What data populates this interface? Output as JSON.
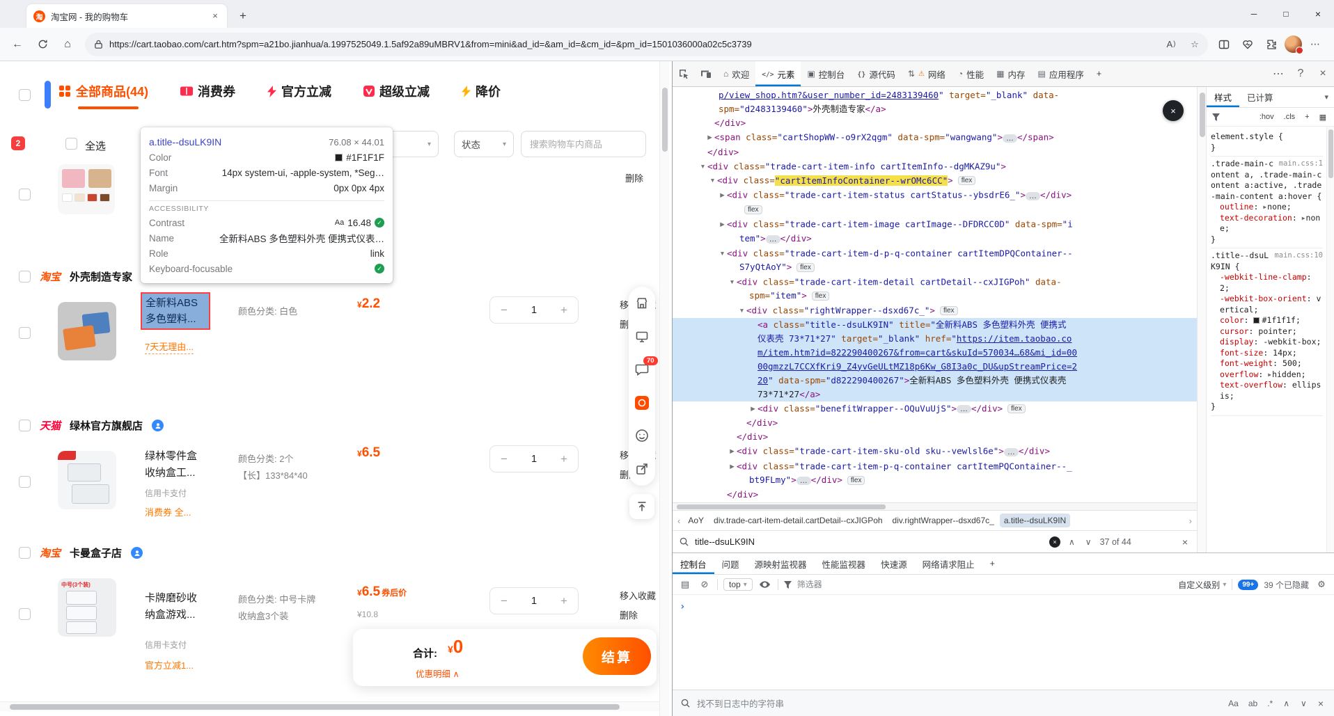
{
  "browser": {
    "tab": {
      "title": "淘宝网 - 我的购物车",
      "favicon_glyph": "淘"
    },
    "address": {
      "url": "https://cart.taobao.com/cart.htm?spm=a21bo.jianhua/a.1997525049.1.5af92a89uMBRV1&from=mini&ad_id=&am_id=&cm_id=&pm_id=1501036000a02c5c3739"
    }
  },
  "cart": {
    "nav_tabs": [
      {
        "label": "全部商品(44)"
      },
      {
        "label": "消费券"
      },
      {
        "label": "官方立减"
      },
      {
        "label": "超级立减"
      },
      {
        "label": "降价"
      }
    ],
    "filter_bar": {
      "select_all": "全选",
      "status": "状态",
      "search_placeholder": "搜索购物车内商品"
    },
    "badge_2": "2",
    "ops": {
      "move": "移入收藏",
      "del": "删除"
    },
    "inspect_tooltip": {
      "element": "a.title--dsuLK9IN",
      "size": "76.08 × 44.01",
      "color_label": "Color",
      "color_value": "#1F1F1F",
      "font_label": "Font",
      "font_value": "14px system-ui, -apple-system, *Seg…",
      "margin_label": "Margin",
      "margin_value": "0px 0px 4px",
      "a11y_header": "ACCESSIBILITY",
      "contrast_label": "Contrast",
      "contrast_aa": "Aa",
      "contrast_value": "16.48",
      "name_label": "Name",
      "name_value": "全新料ABS 多色塑料外壳 便携式仪表…",
      "role_label": "Role",
      "role_value": "link",
      "kbd_label": "Keyboard-focusable"
    },
    "shops": [
      {
        "platform": "淘宝",
        "name": "外壳制造专家",
        "item": {
          "title_l1": "全新料ABS",
          "title_l2": "多色塑料...",
          "promo": "7天无理由...",
          "sku1": "颜色分类: 白色",
          "price": "2.2",
          "qty": "1"
        }
      },
      {
        "platform": "天猫",
        "name": "绿林官方旗舰店",
        "item": {
          "title_l1": "绿林零件盒",
          "title_l2": "收纳盒工...",
          "pay": "信用卡支付",
          "promo": "消费券 全...",
          "sku1": "颜色分类: 2个",
          "sku2": "【长】133*84*40",
          "price": "6.5",
          "qty": "1"
        }
      },
      {
        "platform": "淘宝",
        "name": "卡曼盒子店",
        "item": {
          "title_l1": "卡牌磨砂收",
          "title_l2": "纳盒游戏...",
          "pay": "信用卡支付",
          "promo": "官方立减1...",
          "sku1": "颜色分类: 中号卡牌",
          "sku2": "收纳盒3个装",
          "price": "6.5",
          "price_note": "券后价",
          "price_old": "¥10.8",
          "image_label": "中号(3个装)",
          "qty": "1"
        }
      }
    ],
    "summary": {
      "label": "合计:",
      "currency": "¥",
      "amount": "0",
      "detail": "优惠明细",
      "checkout": "结算"
    },
    "side_toolbar": {
      "chat_badge": "70"
    }
  },
  "devtools": {
    "tabs": [
      {
        "label": "欢迎"
      },
      {
        "label": "元素"
      },
      {
        "label": "控制台"
      },
      {
        "label": "源代码"
      },
      {
        "label": "网络"
      },
      {
        "label": "性能"
      },
      {
        "label": "内存"
      },
      {
        "label": "应用程序"
      }
    ],
    "dom_lines": [
      {
        "ind": 66,
        "seg": [
          [
            "u",
            "p/view_shop.htm?&user_number_id=2483139460"
          ],
          [
            "v",
            "\""
          ],
          [
            "n",
            " target="
          ],
          [
            "v",
            "\"_blank\""
          ],
          [
            "n",
            " data-"
          ]
        ]
      },
      {
        "ind": 66,
        "seg": [
          [
            "n",
            "spm="
          ],
          [
            "v",
            "\"d2483139460\""
          ],
          [
            "p",
            ">"
          ],
          [
            "tx",
            "外壳制造专家"
          ],
          [
            "p",
            "</a>"
          ]
        ]
      },
      {
        "ind": 60,
        "seg": [
          [
            "p",
            "</div>"
          ]
        ]
      },
      {
        "ind": 60,
        "seg": [
          [
            "ar",
            ""
          ],
          [
            "p",
            "<span"
          ],
          [
            "n",
            " class="
          ],
          [
            "v",
            "\"cartShopWW--o9rX2qgm\""
          ],
          [
            "n",
            " data-spm="
          ],
          [
            "v",
            "\"wangwang\""
          ],
          [
            "p",
            ">"
          ],
          [
            "el",
            ""
          ],
          [
            "p",
            "</span>"
          ]
        ]
      },
      {
        "ind": 50,
        "seg": [
          [
            "p",
            "</div>"
          ]
        ]
      },
      {
        "ind": 50,
        "seg": [
          [
            "ad",
            ""
          ],
          [
            "p",
            "<div"
          ],
          [
            "n",
            " class="
          ],
          [
            "v",
            "\"trade-cart-item-info cartItemInfo--dgMKAZ9u\""
          ],
          [
            "p",
            ">"
          ]
        ]
      },
      {
        "ind": 64,
        "seg": [
          [
            "ad",
            ""
          ],
          [
            "p",
            "<div"
          ],
          [
            "n",
            " class="
          ],
          [
            "vh",
            "\"cartItemInfoContainer--wrOMc6CC\""
          ],
          [
            "p",
            ">"
          ],
          [
            "fx",
            ""
          ]
        ]
      },
      {
        "ind": 78,
        "seg": [
          [
            "ar",
            ""
          ],
          [
            "p",
            "<div"
          ],
          [
            "n",
            " class="
          ],
          [
            "v",
            "\"trade-cart-item-status cartStatus--ybsdrE6_\""
          ],
          [
            "p",
            ">"
          ],
          [
            "el",
            ""
          ],
          [
            "p",
            "</div>"
          ]
        ]
      },
      {
        "ind": 96,
        "seg": [
          [
            "fx",
            ""
          ]
        ]
      },
      {
        "ind": 78,
        "seg": [
          [
            "ar",
            ""
          ],
          [
            "p",
            "<div"
          ],
          [
            "n",
            " class="
          ],
          [
            "v",
            "\"trade-cart-item-image cartImage--DFDRCC0D\""
          ],
          [
            "n",
            " data-spm="
          ],
          [
            "v",
            "\"i"
          ]
        ]
      },
      {
        "ind": 96,
        "seg": [
          [
            "v",
            "tem\""
          ],
          [
            "p",
            ">"
          ],
          [
            "el",
            ""
          ],
          [
            "p",
            "</div>"
          ]
        ]
      },
      {
        "ind": 78,
        "seg": [
          [
            "ad",
            ""
          ],
          [
            "p",
            "<div"
          ],
          [
            "n",
            " class="
          ],
          [
            "v",
            "\"trade-cart-item-d-p-q-container cartItemDPQContainer--"
          ]
        ]
      },
      {
        "ind": 96,
        "seg": [
          [
            "v",
            "S7yQtAoY\""
          ],
          [
            "p",
            ">"
          ],
          [
            "fx",
            ""
          ]
        ]
      },
      {
        "ind": 92,
        "seg": [
          [
            "ad",
            ""
          ],
          [
            "p",
            "<div"
          ],
          [
            "n",
            " class="
          ],
          [
            "v",
            "\"trade-cart-item-detail cartDetail--cxJIGPoh\""
          ],
          [
            "n",
            " data-"
          ]
        ]
      },
      {
        "ind": 110,
        "seg": [
          [
            "n",
            "spm="
          ],
          [
            "v",
            "\"item\""
          ],
          [
            "p",
            ">"
          ],
          [
            "fx",
            ""
          ]
        ]
      },
      {
        "ind": 106,
        "seg": [
          [
            "ad",
            ""
          ],
          [
            "p",
            "<div"
          ],
          [
            "n",
            " class="
          ],
          [
            "v",
            "\"rightWrapper--dsxd67c_\""
          ],
          [
            "p",
            ">"
          ],
          [
            "fx",
            ""
          ]
        ]
      },
      {
        "ind": 122,
        "sel": true,
        "seg": [
          [
            "p",
            "<a"
          ],
          [
            "n",
            " class="
          ],
          [
            "v",
            "\"title--dsuLK9IN\""
          ],
          [
            "n",
            " title="
          ],
          [
            "v",
            "\"全新料ABS 多色塑料外壳 便携式"
          ]
        ]
      },
      {
        "ind": 122,
        "sel": true,
        "seg": [
          [
            "v",
            "仪表壳 73*71*27\""
          ],
          [
            "n",
            " target="
          ],
          [
            "v",
            "\"_blank\""
          ],
          [
            "n",
            " href="
          ],
          [
            "v",
            "\""
          ],
          [
            "u",
            "https://item.taobao.co"
          ]
        ]
      },
      {
        "ind": 122,
        "sel": true,
        "seg": [
          [
            "u",
            "m/item.htm?id=822290400267&from=cart&skuId=570034…68&mi_id=00"
          ]
        ]
      },
      {
        "ind": 122,
        "sel": true,
        "seg": [
          [
            "u",
            "00gmzzL7CCXfKri9_Z4yvGeULtMZ18p6Kw_G8I3a0c_DU&upStreamPrice=2"
          ]
        ]
      },
      {
        "ind": 122,
        "sel": true,
        "seg": [
          [
            "u",
            "20"
          ],
          [
            "v",
            "\""
          ],
          [
            "n",
            " data-spm="
          ],
          [
            "v",
            "\"d822290400267\""
          ],
          [
            "p",
            ">"
          ],
          [
            "tx",
            "全新料ABS 多色塑料外壳 便携式仪表壳"
          ]
        ]
      },
      {
        "ind": 122,
        "sel": true,
        "seg": [
          [
            "tx",
            "73*71*27"
          ],
          [
            "p",
            "</a>"
          ]
        ]
      },
      {
        "ind": 122,
        "seg": [
          [
            "ar",
            ""
          ],
          [
            "p",
            "<div"
          ],
          [
            "n",
            " class="
          ],
          [
            "v",
            "\"benefitWrapper--OQuVuUjS\""
          ],
          [
            "p",
            ">"
          ],
          [
            "el",
            ""
          ],
          [
            "p",
            "</div>"
          ],
          [
            "fx",
            ""
          ]
        ]
      },
      {
        "ind": 106,
        "seg": [
          [
            "p",
            "</div>"
          ]
        ]
      },
      {
        "ind": 92,
        "seg": [
          [
            "p",
            "</div>"
          ]
        ]
      },
      {
        "ind": 92,
        "seg": [
          [
            "ar",
            ""
          ],
          [
            "p",
            "<div"
          ],
          [
            "n",
            " class="
          ],
          [
            "v",
            "\"trade-cart-item-sku-old sku--vewlsl6e\""
          ],
          [
            "p",
            ">"
          ],
          [
            "el",
            ""
          ],
          [
            "p",
            "</div>"
          ]
        ]
      },
      {
        "ind": 92,
        "seg": [
          [
            "ar",
            ""
          ],
          [
            "p",
            "<div"
          ],
          [
            "n",
            " class="
          ],
          [
            "v",
            "\"trade-cart-item-p-q-container cartItemPQContainer--_"
          ]
        ]
      },
      {
        "ind": 110,
        "seg": [
          [
            "v",
            "bt9FLmy\""
          ],
          [
            "p",
            ">"
          ],
          [
            "el",
            ""
          ],
          [
            "p",
            "</div>"
          ],
          [
            "fx",
            ""
          ]
        ]
      },
      {
        "ind": 78,
        "seg": [
          [
            "p",
            "</div>"
          ]
        ]
      },
      {
        "ind": 64,
        "seg": [
          [
            "ar",
            ""
          ],
          [
            "p",
            "<div"
          ],
          [
            "n",
            " class="
          ],
          [
            "v",
            "\"trade-cart-item-operation cartOperation--K9S4hOC3\""
          ],
          [
            "p",
            ">"
          ],
          [
            "el",
            ""
          ]
        ]
      }
    ],
    "breadcrumbs": [
      {
        "label": "AoY"
      },
      {
        "label": "div.trade-cart-item-detail.cartDetail--cxJIGPoh"
      },
      {
        "label": "div.rightWrapper--dsxd67c_"
      },
      {
        "label": "a.title--dsuLK9IN"
      }
    ],
    "search": {
      "query": "title--dsuLK9IN",
      "results": "37 of 44"
    },
    "console": {
      "tabs": [
        {
          "label": "控制台"
        },
        {
          "label": "问题"
        },
        {
          "label": "源映射监视器"
        },
        {
          "label": "性能监视器"
        },
        {
          "label": "快速源"
        },
        {
          "label": "网络请求阻止"
        }
      ],
      "context": "top",
      "filter_placeholder": "筛选器",
      "levels": "自定义级别",
      "messages_badge": "99+",
      "hidden_count": "39 个已隐藏",
      "find_placeholder": "找不到日志中的字符串"
    },
    "styles": {
      "tabs": [
        {
          "label": "样式"
        },
        {
          "label": "已计算"
        }
      ],
      "pseudo": ":hov",
      "cls": ".cls",
      "plus": "+",
      "rules": [
        {
          "selector": "element.style",
          "link": "",
          "props": []
        },
        {
          "selector": ".trade-main-content a, .trade-main-content a:active, .trade-main-content a:hover",
          "link": "main.css:1",
          "props": [
            {
              "name": "outline",
              "value": "none",
              "arrow": true
            },
            {
              "name": "text-decoration",
              "value": "none",
              "arrow": true
            }
          ]
        },
        {
          "selector": ".title--dsuLK9IN",
          "link": "main.css:10",
          "props": [
            {
              "name": "-webkit-line-clamp",
              "value": "2"
            },
            {
              "name": "-webkit-box-orient",
              "value": "vertical"
            },
            {
              "name": "color",
              "value": "#1f1f1f",
              "swatch": "#1f1f1f"
            },
            {
              "name": "cursor",
              "value": "pointer"
            },
            {
              "name": "display",
              "value": "-webkit-box"
            },
            {
              "name": "font-size",
              "value": "14px"
            },
            {
              "name": "font-weight",
              "value": "500"
            },
            {
              "name": "overflow",
              "value": "hidden",
              "arrow": true
            },
            {
              "name": "text-overflow",
              "value": "ellipsis"
            }
          ]
        }
      ]
    }
  }
}
